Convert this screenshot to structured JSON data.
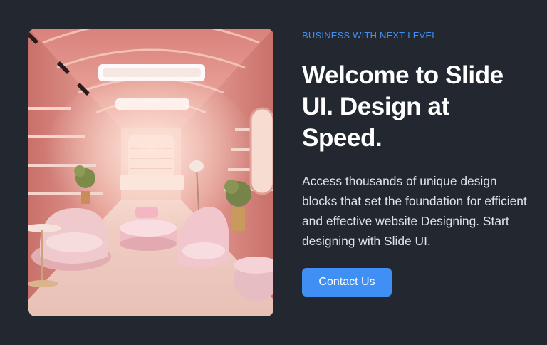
{
  "hero": {
    "eyebrow": "BUSINESS WITH NEXT-LEVEL",
    "headline": "Welcome to Slide UI. Design at Speed.",
    "description": "Access thousands of unique design blocks that set the foundation for efficient and effective website Designing. Start designing with Slide UI.",
    "cta_label": "Contact Us"
  },
  "colors": {
    "background": "#232830",
    "accent": "#3f8ff5",
    "heading": "#ffffff",
    "body_text": "#dfe3e8"
  }
}
